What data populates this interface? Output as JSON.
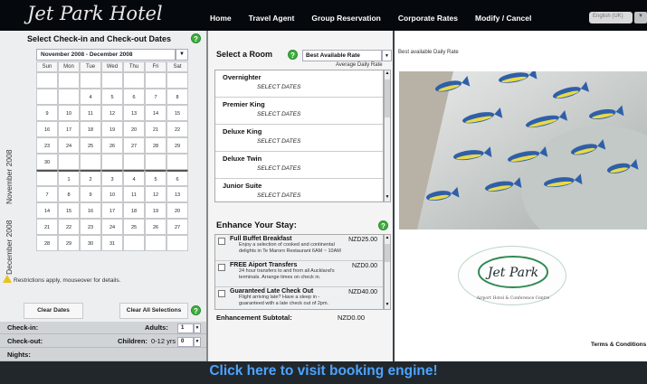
{
  "brand": {
    "logo_text": "Jet Park Hotel"
  },
  "nav": {
    "items": [
      "Home",
      "Travel Agent",
      "Group Reservation",
      "Corporate Rates",
      "Modify / Cancel"
    ]
  },
  "language": {
    "selected": "English (UK)"
  },
  "calendar": {
    "title": "Select Check-in and Check-out Dates",
    "month_range": "November 2008 - December 2008",
    "weekdays": [
      "Sun",
      "Mon",
      "Tue",
      "Wed",
      "Thu",
      "Fri",
      "Sat"
    ],
    "month_labels": [
      "November 2008",
      "December 2008"
    ],
    "rows": [
      [
        "",
        "",
        "",
        "",
        "",
        "",
        ""
      ],
      [
        "",
        "",
        "4",
        "5",
        "6",
        "7",
        "8"
      ],
      [
        "9",
        "10",
        "11",
        "12",
        "13",
        "14",
        "15"
      ],
      [
        "16",
        "17",
        "18",
        "19",
        "20",
        "21",
        "22"
      ],
      [
        "23",
        "24",
        "25",
        "26",
        "27",
        "28",
        "29"
      ],
      [
        "30",
        "",
        "",
        "",
        "",
        "",
        ""
      ],
      [
        "",
        "1",
        "2",
        "3",
        "4",
        "5",
        "6"
      ],
      [
        "7",
        "8",
        "9",
        "10",
        "11",
        "12",
        "13"
      ],
      [
        "14",
        "15",
        "16",
        "17",
        "18",
        "19",
        "20"
      ],
      [
        "21",
        "22",
        "23",
        "24",
        "25",
        "26",
        "27"
      ],
      [
        "28",
        "29",
        "30",
        "31",
        "",
        "",
        ""
      ]
    ],
    "restrictions": "Restrictions apply, mouseover for details.",
    "clear_dates": "Clear Dates",
    "clear_all": "Clear All Selections"
  },
  "summary": {
    "checkin": "Check-in:",
    "checkout": "Check-out:",
    "nights": "Nights:",
    "adults_label": "Adults:",
    "adults_value": "1",
    "children_label": "Children:",
    "children_ages": "0-12 yrs",
    "children_value": "0"
  },
  "rooms": {
    "title": "Select a Room",
    "rate_selected": "Best Available Rate",
    "avg_rate_label": "Average Daily Rate",
    "items": [
      {
        "name": "Overnighter",
        "status": "SELECT DATES"
      },
      {
        "name": "Premier King",
        "status": "SELECT DATES"
      },
      {
        "name": "Deluxe King",
        "status": "SELECT DATES"
      },
      {
        "name": "Deluxe Twin",
        "status": "SELECT DATES"
      },
      {
        "name": "Junior Suite",
        "status": "SELECT DATES"
      }
    ]
  },
  "enhance": {
    "title": "Enhance Your Stay:",
    "items": [
      {
        "name": "Full Buffet Breakfast",
        "price": "NZD25.00",
        "desc1": "Enjoy a selection of cooked and continental",
        "desc2": "delights in Te Maroro Restaurant 6AM ~ 10AM"
      },
      {
        "name": "FREE Aiport Transfers",
        "price": "NZD0.00",
        "desc1": "24 hour transfers to and from all Auckland's",
        "desc2": "terminals. Arrange times on check in."
      },
      {
        "name": "Guaranteed Late Check Out",
        "price": "NZD40.00",
        "desc1": "Flight arriving late? Have a sleep in -",
        "desc2": "guaranteed with a late check out of 2pm."
      }
    ],
    "subtotal_label": "Enhancement Subtotal:",
    "subtotal_value": "NZD0.00"
  },
  "right": {
    "best_rate": "Best available Daily Rate",
    "logo_text": "Jet Park",
    "logo_sub": "Airport Hotel & Conference Centre",
    "terms": "Terms & Conditions"
  },
  "cta": "Click here to visit booking engine!",
  "colors": {
    "accent": "#3fae3f",
    "cta": "#4da3ff",
    "topbar": "#05090d"
  }
}
